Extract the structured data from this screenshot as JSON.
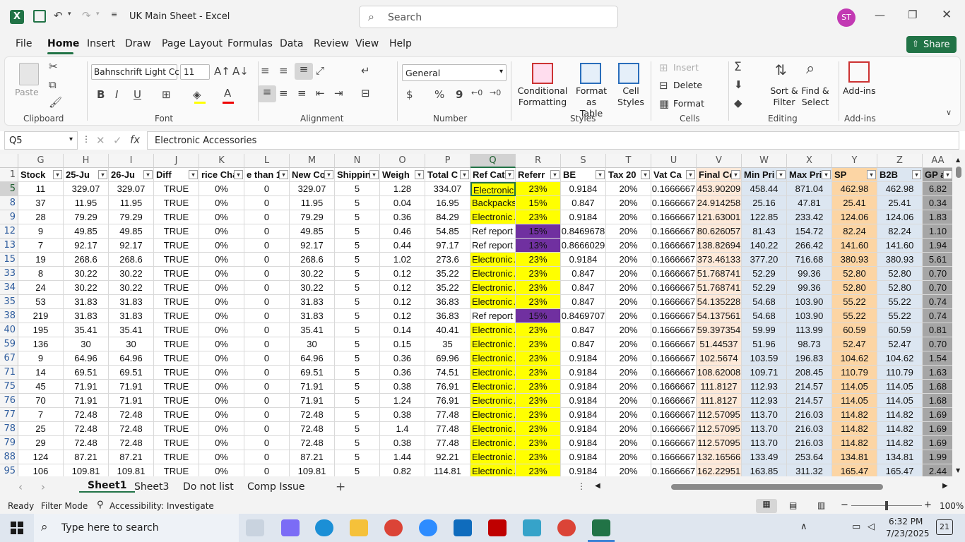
{
  "window": {
    "title": "UK Main Sheet  -  Excel",
    "search_placeholder": "Search",
    "user_initials": "ST"
  },
  "menu": [
    "File",
    "Home",
    "Insert",
    "Draw",
    "Page Layout",
    "Formulas",
    "Data",
    "Review",
    "View",
    "Help"
  ],
  "share_label": "Share",
  "ribbon": {
    "clipboard": {
      "paste": "Paste",
      "group": "Clipboard"
    },
    "font": {
      "name": "Bahnschrift Light Cc",
      "size": "11",
      "group": "Font",
      "bold": "B",
      "italic": "I",
      "underline": "U"
    },
    "alignment": {
      "group": "Alignment"
    },
    "number": {
      "format": "General",
      "group": "Number",
      "currency": "$",
      "percent": "%",
      "comma": "9"
    },
    "styles": {
      "conditional": "Conditional",
      "conditional2": "Formatting",
      "format_table": "Format as",
      "format_table2": "Table",
      "cell_styles": "Cell",
      "cell_styles2": "Styles",
      "group": "Styles"
    },
    "cells": {
      "insert": "Insert",
      "delete": "Delete",
      "format": "Format",
      "group": "Cells"
    },
    "editing": {
      "sort": "Sort &",
      "sort2": "Filter",
      "find": "Find &",
      "find2": "Select",
      "group": "Editing"
    },
    "addins": {
      "label": "Add-ins",
      "group": "Add-ins"
    }
  },
  "namebox": "Q5",
  "formula": "Electronic Accessories",
  "columns": [
    "G",
    "H",
    "I",
    "J",
    "K",
    "L",
    "M",
    "N",
    "O",
    "P",
    "Q",
    "R",
    "S",
    "T",
    "U",
    "V",
    "W",
    "X",
    "Y",
    "Z",
    "AA"
  ],
  "headers": [
    "Stock",
    "25-Ju",
    "26-Ju",
    "Diff",
    "rice Cha",
    "e than 1",
    "New Co",
    "Shippin",
    "Weigh",
    "Total C",
    "Ref Cat",
    "Referr",
    "BE",
    "Tax 20",
    "Vat Ca",
    "Final Co",
    "Min Pri",
    "Max Pri",
    "SP",
    "B2B",
    "GP at"
  ],
  "rows": [
    {
      "n": "5",
      "c": [
        "11",
        "329.07",
        "329.07",
        "TRUE",
        "0%",
        "0",
        "329.07",
        "5",
        "1.28",
        "334.07",
        "Electronic A",
        "23%",
        "0.9184",
        "20%",
        "0.1666667",
        "453.90209",
        "458.44",
        "871.04",
        "462.98",
        "462.98",
        "6.82"
      ]
    },
    {
      "n": "8",
      "c": [
        "37",
        "11.95",
        "11.95",
        "TRUE",
        "0%",
        "0",
        "11.95",
        "5",
        "0.04",
        "16.95",
        "Backpacks a",
        "15%",
        "0.847",
        "20%",
        "0.1666667",
        "24.914258",
        "25.16",
        "47.81",
        "25.41",
        "25.41",
        "0.34"
      ]
    },
    {
      "n": "9",
      "c": [
        "28",
        "79.29",
        "79.29",
        "TRUE",
        "0%",
        "0",
        "79.29",
        "5",
        "0.36",
        "84.29",
        "Electronic A",
        "23%",
        "0.9184",
        "20%",
        "0.1666667",
        "121.63001",
        "122.85",
        "233.42",
        "124.06",
        "124.06",
        "1.83"
      ]
    },
    {
      "n": "12",
      "c": [
        "9",
        "49.85",
        "49.85",
        "TRUE",
        "0%",
        "0",
        "49.85",
        "5",
        "0.46",
        "54.85",
        "Ref report",
        "15%",
        "0.8469678",
        "20%",
        "0.1666667",
        "80.626057",
        "81.43",
        "154.72",
        "82.24",
        "82.24",
        "1.10"
      ]
    },
    {
      "n": "13",
      "c": [
        "7",
        "92.17",
        "92.17",
        "TRUE",
        "0%",
        "0",
        "92.17",
        "5",
        "0.44",
        "97.17",
        "Ref report",
        "13%",
        "0.8666029",
        "20%",
        "0.1666667",
        "138.82694",
        "140.22",
        "266.42",
        "141.60",
        "141.60",
        "1.94"
      ]
    },
    {
      "n": "15",
      "c": [
        "19",
        "268.6",
        "268.6",
        "TRUE",
        "0%",
        "0",
        "268.6",
        "5",
        "1.02",
        "273.6",
        "Electronic A",
        "23%",
        "0.9184",
        "20%",
        "0.1666667",
        "373.46133",
        "377.20",
        "716.68",
        "380.93",
        "380.93",
        "5.61"
      ]
    },
    {
      "n": "33",
      "c": [
        "8",
        "30.22",
        "30.22",
        "TRUE",
        "0%",
        "0",
        "30.22",
        "5",
        "0.12",
        "35.22",
        "Electronic A",
        "23%",
        "0.847",
        "20%",
        "0.1666667",
        "51.768741",
        "52.29",
        "99.36",
        "52.80",
        "52.80",
        "0.70"
      ]
    },
    {
      "n": "34",
      "c": [
        "24",
        "30.22",
        "30.22",
        "TRUE",
        "0%",
        "0",
        "30.22",
        "5",
        "0.12",
        "35.22",
        "Electronic A",
        "23%",
        "0.847",
        "20%",
        "0.1666667",
        "51.768741",
        "52.29",
        "99.36",
        "52.80",
        "52.80",
        "0.70"
      ]
    },
    {
      "n": "35",
      "c": [
        "53",
        "31.83",
        "31.83",
        "TRUE",
        "0%",
        "0",
        "31.83",
        "5",
        "0.12",
        "36.83",
        "Electronic A",
        "23%",
        "0.847",
        "20%",
        "0.1666667",
        "54.135228",
        "54.68",
        "103.90",
        "55.22",
        "55.22",
        "0.74"
      ]
    },
    {
      "n": "38",
      "c": [
        "219",
        "31.83",
        "31.83",
        "TRUE",
        "0%",
        "0",
        "31.83",
        "5",
        "0.12",
        "36.83",
        "Ref report",
        "15%",
        "0.8469707",
        "20%",
        "0.1666667",
        "54.137561",
        "54.68",
        "103.90",
        "55.22",
        "55.22",
        "0.74"
      ]
    },
    {
      "n": "40",
      "c": [
        "195",
        "35.41",
        "35.41",
        "TRUE",
        "0%",
        "0",
        "35.41",
        "5",
        "0.14",
        "40.41",
        "Electronic A",
        "23%",
        "0.847",
        "20%",
        "0.1666667",
        "59.397354",
        "59.99",
        "113.99",
        "60.59",
        "60.59",
        "0.81"
      ]
    },
    {
      "n": "59",
      "c": [
        "136",
        "30",
        "30",
        "TRUE",
        "0%",
        "0",
        "30",
        "5",
        "0.15",
        "35",
        "Electronic A",
        "23%",
        "0.847",
        "20%",
        "0.1666667",
        "51.44537",
        "51.96",
        "98.73",
        "52.47",
        "52.47",
        "0.70"
      ]
    },
    {
      "n": "67",
      "c": [
        "9",
        "64.96",
        "64.96",
        "TRUE",
        "0%",
        "0",
        "64.96",
        "5",
        "0.36",
        "69.96",
        "Electronic A",
        "23%",
        "0.9184",
        "20%",
        "0.1666667",
        "102.5674",
        "103.59",
        "196.83",
        "104.62",
        "104.62",
        "1.54"
      ]
    },
    {
      "n": "71",
      "c": [
        "14",
        "69.51",
        "69.51",
        "TRUE",
        "0%",
        "0",
        "69.51",
        "5",
        "0.36",
        "74.51",
        "Electronic A",
        "23%",
        "0.9184",
        "20%",
        "0.1666667",
        "108.62008",
        "109.71",
        "208.45",
        "110.79",
        "110.79",
        "1.63"
      ]
    },
    {
      "n": "75",
      "c": [
        "45",
        "71.91",
        "71.91",
        "TRUE",
        "0%",
        "0",
        "71.91",
        "5",
        "0.38",
        "76.91",
        "Electronic A",
        "23%",
        "0.9184",
        "20%",
        "0.1666667",
        "111.8127",
        "112.93",
        "214.57",
        "114.05",
        "114.05",
        "1.68"
      ]
    },
    {
      "n": "76",
      "c": [
        "70",
        "71.91",
        "71.91",
        "TRUE",
        "0%",
        "0",
        "71.91",
        "5",
        "1.24",
        "76.91",
        "Electronic A",
        "23%",
        "0.9184",
        "20%",
        "0.1666667",
        "111.8127",
        "112.93",
        "214.57",
        "114.05",
        "114.05",
        "1.68"
      ]
    },
    {
      "n": "77",
      "c": [
        "7",
        "72.48",
        "72.48",
        "TRUE",
        "0%",
        "0",
        "72.48",
        "5",
        "0.38",
        "77.48",
        "Electronic A",
        "23%",
        "0.9184",
        "20%",
        "0.1666667",
        "112.57095",
        "113.70",
        "216.03",
        "114.82",
        "114.82",
        "1.69"
      ]
    },
    {
      "n": "78",
      "c": [
        "25",
        "72.48",
        "72.48",
        "TRUE",
        "0%",
        "0",
        "72.48",
        "5",
        "1.4",
        "77.48",
        "Electronic A",
        "23%",
        "0.9184",
        "20%",
        "0.1666667",
        "112.57095",
        "113.70",
        "216.03",
        "114.82",
        "114.82",
        "1.69"
      ]
    },
    {
      "n": "79",
      "c": [
        "29",
        "72.48",
        "72.48",
        "TRUE",
        "0%",
        "0",
        "72.48",
        "5",
        "0.38",
        "77.48",
        "Electronic A",
        "23%",
        "0.9184",
        "20%",
        "0.1666667",
        "112.57095",
        "113.70",
        "216.03",
        "114.82",
        "114.82",
        "1.69"
      ]
    },
    {
      "n": "88",
      "c": [
        "124",
        "87.21",
        "87.21",
        "TRUE",
        "0%",
        "0",
        "87.21",
        "5",
        "1.44",
        "92.21",
        "Electronic A",
        "23%",
        "0.9184",
        "20%",
        "0.1666667",
        "132.16566",
        "133.49",
        "253.64",
        "134.81",
        "134.81",
        "1.99"
      ]
    },
    {
      "n": "95",
      "c": [
        "106",
        "109.81",
        "109.81",
        "TRUE",
        "0%",
        "0",
        "109.81",
        "5",
        "0.82",
        "114.81",
        "Electronic A",
        "23%",
        "0.9184",
        "20%",
        "0.1666667",
        "162.22951",
        "163.85",
        "311.32",
        "165.47",
        "165.47",
        "2.44"
      ]
    }
  ],
  "sheets": [
    "Sheet1",
    "Sheet3",
    "Do not list",
    "Comp Issue"
  ],
  "status": {
    "ready": "Ready",
    "filter": "Filter Mode",
    "accessibility": "Accessibility: Investigate",
    "zoom": "100%"
  },
  "taskbar": {
    "search_placeholder": "Type here to search",
    "time": "6:32 PM",
    "date": "7/23/2025",
    "notif": "21"
  },
  "colors": {
    "yellow": "#ffff00",
    "purple": "#7030a0",
    "peach": "#fde9d9",
    "blue": "#dce6f1",
    "orange": "#fcd5a4",
    "gray": "#a6a6a6",
    "excel_green": "#217346"
  }
}
